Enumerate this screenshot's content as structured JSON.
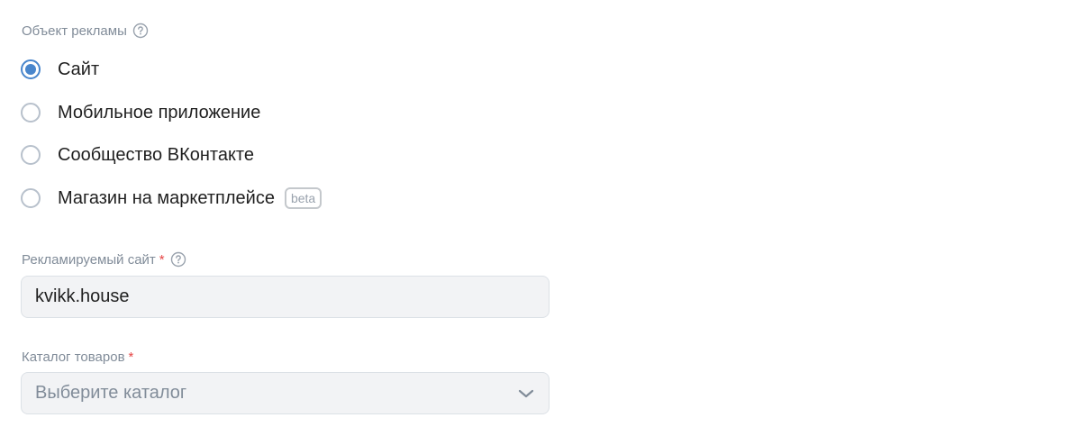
{
  "ad_object": {
    "label": "Объект рекламы",
    "options": [
      {
        "label": "Сайт",
        "selected": true
      },
      {
        "label": "Мобильное приложение",
        "selected": false
      },
      {
        "label": "Сообщество ВКонтакте",
        "selected": false
      },
      {
        "label": "Магазин на маркетплейсе",
        "selected": false,
        "badge": "beta"
      }
    ]
  },
  "site_field": {
    "label": "Рекламируемый сайт",
    "required_mark": "*",
    "value": "kvikk.house"
  },
  "catalog_field": {
    "label": "Каталог товаров",
    "required_mark": "*",
    "placeholder": "Выберите каталог"
  },
  "colors": {
    "accent": "#4986cc",
    "required": "#e64646",
    "muted_text": "#818c99",
    "field_bg": "#f2f3f5"
  },
  "icons": {
    "help": "question-circle-icon",
    "dropdown": "chevron-down-icon"
  }
}
